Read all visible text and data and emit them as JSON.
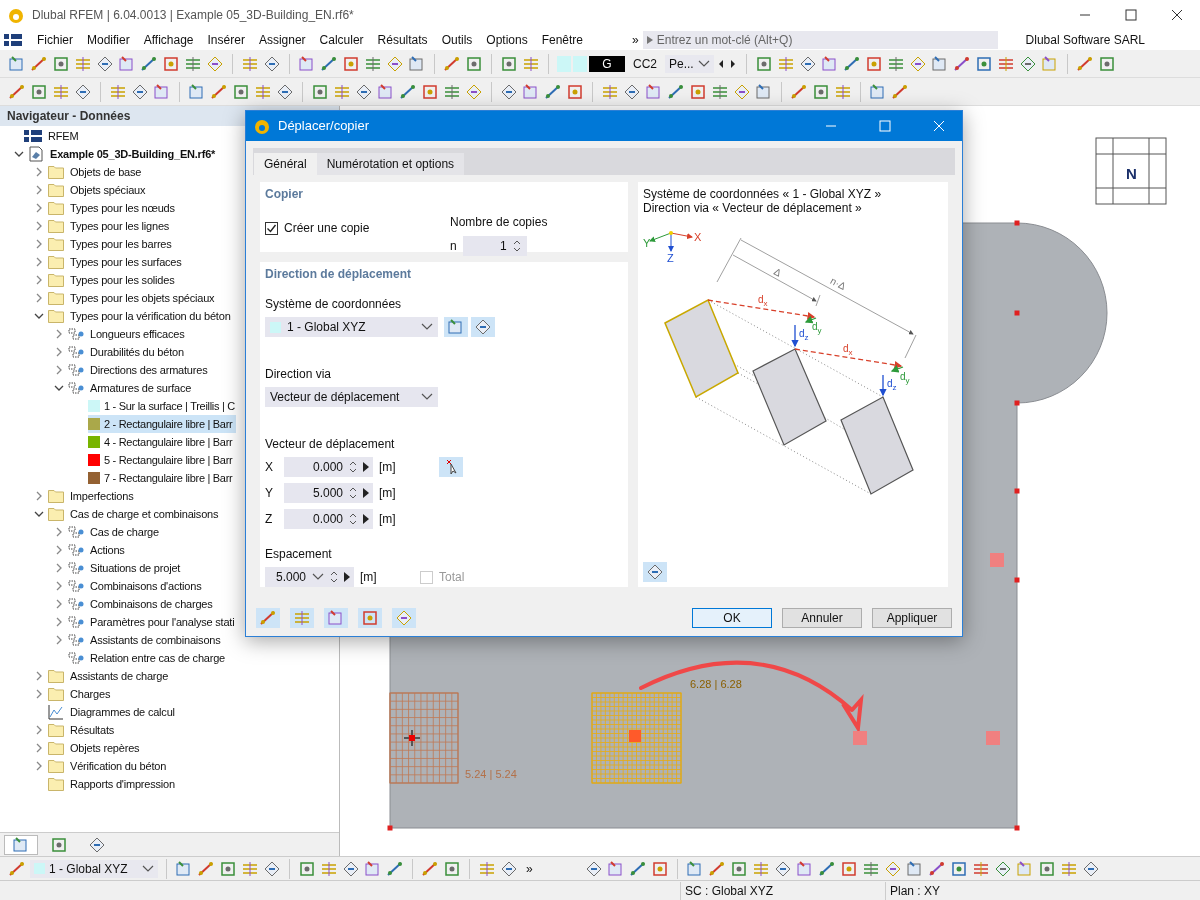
{
  "window": {
    "title": "Dlubal RFEM | 6.04.0013 | Example 05_3D-Building_EN.rf6*"
  },
  "menu": {
    "items": [
      "Fichier",
      "Modifier",
      "Affichage",
      "Insérer",
      "Assigner",
      "Calculer",
      "Résultats",
      "Outils",
      "Options",
      "Fenêtre"
    ],
    "overflow": "»",
    "search_placeholder": "Entrez un mot-clé (Alt+Q)",
    "company": "Dlubal Software SARL"
  },
  "toolbar": {
    "load_type": "G",
    "load_case": "CC2",
    "load_name": "Pe..."
  },
  "navigator": {
    "title": "Navigateur - Données",
    "tree": [
      {
        "kind": "app",
        "label": "RFEM"
      },
      {
        "kind": "model",
        "label": "Example 05_3D-Building_EN.rf6*",
        "expanded": true,
        "children": [
          {
            "kind": "folder",
            "label": "Objets de base",
            "expanded": false
          },
          {
            "kind": "folder",
            "label": "Objets spéciaux",
            "expanded": false
          },
          {
            "kind": "folder",
            "label": "Types pour les nœuds",
            "expanded": false
          },
          {
            "kind": "folder",
            "label": "Types pour les lignes",
            "expanded": false
          },
          {
            "kind": "folder",
            "label": "Types pour les barres",
            "expanded": false
          },
          {
            "kind": "folder",
            "label": "Types pour les surfaces",
            "expanded": false
          },
          {
            "kind": "folder",
            "label": "Types pour les solides",
            "expanded": false
          },
          {
            "kind": "folder",
            "label": "Types pour les objets spéciaux",
            "expanded": false
          },
          {
            "kind": "folder",
            "label": "Types pour la vérification du béton",
            "expanded": true,
            "children": [
              {
                "kind": "item",
                "label": "Longueurs efficaces",
                "expanded": false
              },
              {
                "kind": "item",
                "label": "Durabilités du béton",
                "expanded": false
              },
              {
                "kind": "item",
                "label": "Directions des armatures",
                "expanded": false
              },
              {
                "kind": "item",
                "label": "Armatures de surface",
                "expanded": true,
                "children": [
                  {
                    "kind": "color",
                    "label": "1 - Sur la surface | Treillis | C",
                    "color": "#ccf7f7",
                    "selected": false
                  },
                  {
                    "kind": "color",
                    "label": "2 - Rectangulaire libre | Barr",
                    "color": "#aaa84a",
                    "selected": true
                  },
                  {
                    "kind": "color",
                    "label": "4 - Rectangulaire libre | Barr",
                    "color": "#78b400",
                    "selected": false
                  },
                  {
                    "kind": "color",
                    "label": "5 - Rectangulaire libre | Barr",
                    "color": "#ff0000",
                    "selected": false
                  },
                  {
                    "kind": "color",
                    "label": "7 - Rectangulaire libre | Barr",
                    "color": "#946132",
                    "selected": false
                  }
                ]
              }
            ]
          },
          {
            "kind": "folder",
            "label": "Imperfections",
            "expanded": false
          },
          {
            "kind": "folder",
            "label": "Cas de charge et combinaisons",
            "expanded": true,
            "children": [
              {
                "kind": "item",
                "label": "Cas de charge",
                "expanded": false
              },
              {
                "kind": "item",
                "label": "Actions",
                "expanded": false
              },
              {
                "kind": "item",
                "label": "Situations de projet",
                "expanded": false
              },
              {
                "kind": "item",
                "label": "Combinaisons d'actions",
                "expanded": false
              },
              {
                "kind": "item",
                "label": "Combinaisons de charges",
                "expanded": false
              },
              {
                "kind": "item",
                "label": "Paramètres pour l'analyse stati",
                "expanded": false
              },
              {
                "kind": "item",
                "label": "Assistants de combinaisons",
                "expanded": false
              },
              {
                "kind": "item",
                "label": "Relation entre cas de charge"
              }
            ]
          },
          {
            "kind": "folder",
            "label": "Assistants de charge",
            "expanded": false
          },
          {
            "kind": "folder",
            "label": "Charges",
            "expanded": false
          },
          {
            "kind": "chart",
            "label": "Diagrammes de calcul"
          },
          {
            "kind": "folder",
            "label": "Résultats",
            "expanded": false
          },
          {
            "kind": "folder",
            "label": "Objets repères",
            "expanded": false
          },
          {
            "kind": "folder",
            "label": "Vérification du béton",
            "expanded": false
          },
          {
            "kind": "folder",
            "label": "Rapports d'impression"
          }
        ]
      }
    ],
    "bottom_tabs": [
      {
        "selected": true
      },
      {
        "selected": false
      },
      {
        "selected": false
      }
    ]
  },
  "canvas": {
    "labels": [
      "5.24 | 5.24",
      "6.28 | 6.28"
    ],
    "view_cube_label": "N"
  },
  "dialog": {
    "title": "Déplacer/copier",
    "tabs": [
      {
        "label": "Général",
        "selected": true
      },
      {
        "label": "Numérotation et options",
        "selected": false
      }
    ],
    "copy": {
      "heading": "Copier",
      "create_copy": {
        "label": "Créer une copie",
        "checked": true
      },
      "count_label": "Nombre de copies",
      "count_symbol": "n",
      "count": "1"
    },
    "direction": {
      "heading": "Direction de déplacement",
      "coord_label": "Système de coordonnées",
      "coord_value": "1 - Global XYZ",
      "via_label": "Direction via",
      "via_value": "Vecteur de déplacement",
      "vector_label": "Vecteur de déplacement",
      "vector": [
        {
          "axis": "X",
          "value": "0.000",
          "unit": "[m]"
        },
        {
          "axis": "Y",
          "value": "5.000",
          "unit": "[m]"
        },
        {
          "axis": "Z",
          "value": "0.000",
          "unit": "[m]"
        }
      ],
      "spacing_label": "Espacement",
      "spacing_value": "5.000",
      "spacing_unit": "[m]",
      "total": {
        "label": "Total",
        "checked": false,
        "disabled": true
      }
    },
    "preview": {
      "lines": [
        "Système de coordonnées « 1 - Global XYZ »",
        "Direction via « Vecteur de déplacement »"
      ],
      "axes": [
        "X",
        "Y",
        "Z"
      ],
      "delta": "Δ",
      "n_delta": "n·Δ",
      "d_labels": [
        {
          "base": "d",
          "sub": "x"
        },
        {
          "base": "d",
          "sub": "y"
        },
        {
          "base": "d",
          "sub": "z"
        },
        {
          "base": "d",
          "sub": "x"
        },
        {
          "base": "d",
          "sub": "y"
        },
        {
          "base": "d",
          "sub": "z"
        }
      ]
    },
    "buttons": [
      "OK",
      "Annuler",
      "Appliquer"
    ]
  },
  "bottom_toolbar": {
    "coord_system": "1 - Global XYZ",
    "overflow": "»"
  },
  "status_bar": {
    "cells": [
      "SC : Global XYZ",
      "Plan : XY"
    ]
  }
}
